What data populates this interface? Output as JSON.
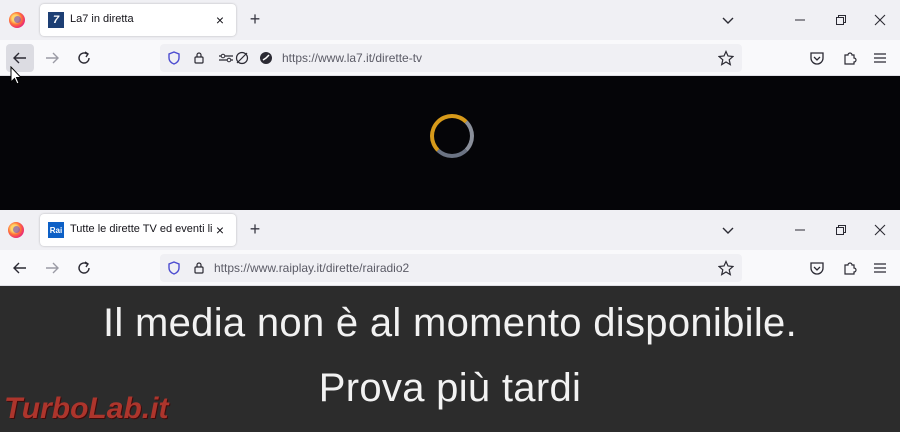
{
  "windows": [
    {
      "tab": {
        "favicon": "7",
        "title": "La7 in diretta",
        "close": "×"
      },
      "newtab": "+",
      "url": "https://www.la7.it/dirette-tv",
      "content": {
        "state": "loading"
      }
    },
    {
      "tab": {
        "favicon": "Rai",
        "title": "Tutte le dirette TV ed eventi live",
        "close": "×"
      },
      "newtab": "+",
      "url": "https://www.raiplay.it/dirette/rairadio2",
      "content": {
        "line1": "Il media non è al momento disponibile.",
        "line2": "Prova più tardi"
      }
    }
  ],
  "watermark": "TurboLab.it",
  "colors": {
    "tabbar": "#f0f0f4",
    "navbar": "#f9f9fb",
    "spinner": "#d79a1a",
    "error_bg": "#2c2c2c",
    "watermark": "#d8382d"
  }
}
